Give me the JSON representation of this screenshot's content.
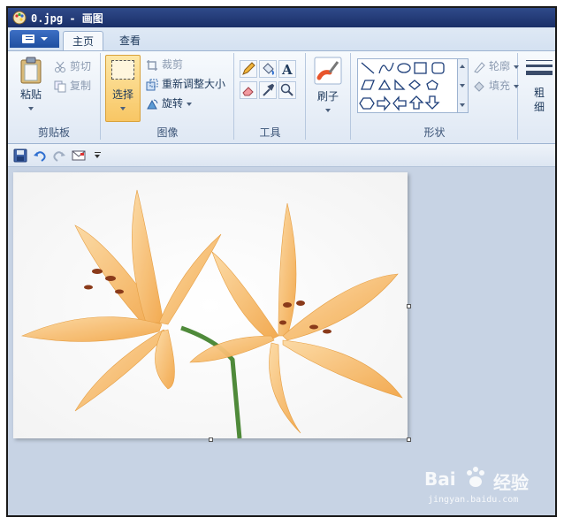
{
  "window": {
    "title": "0.jpg - 画图"
  },
  "tabs": [
    {
      "label": "主页",
      "active": true
    },
    {
      "label": "查看",
      "active": false
    }
  ],
  "clipboard": {
    "paste_label": "粘贴",
    "cut_label": "剪切",
    "copy_label": "复制",
    "group_label": "剪贴板"
  },
  "image": {
    "select_label": "选择",
    "crop_label": "裁剪",
    "resize_label": "重新调整大小",
    "rotate_label": "旋转",
    "group_label": "图像"
  },
  "tools": {
    "group_label": "工具"
  },
  "brushes": {
    "label": "刷子"
  },
  "shapes": {
    "outline_label": "轮廓",
    "fill_label": "填充",
    "group_label": "形状"
  },
  "size": {
    "label": "粗细"
  },
  "watermark": {
    "brand": "Bai",
    "brand2": "经验",
    "url": "jingyan.baidu.com"
  },
  "colors": {
    "accent": "#f5c06a",
    "titlebar": "#1a2f68",
    "ribbon": "#dfe8f4",
    "workspace": "#c7d3e4"
  }
}
